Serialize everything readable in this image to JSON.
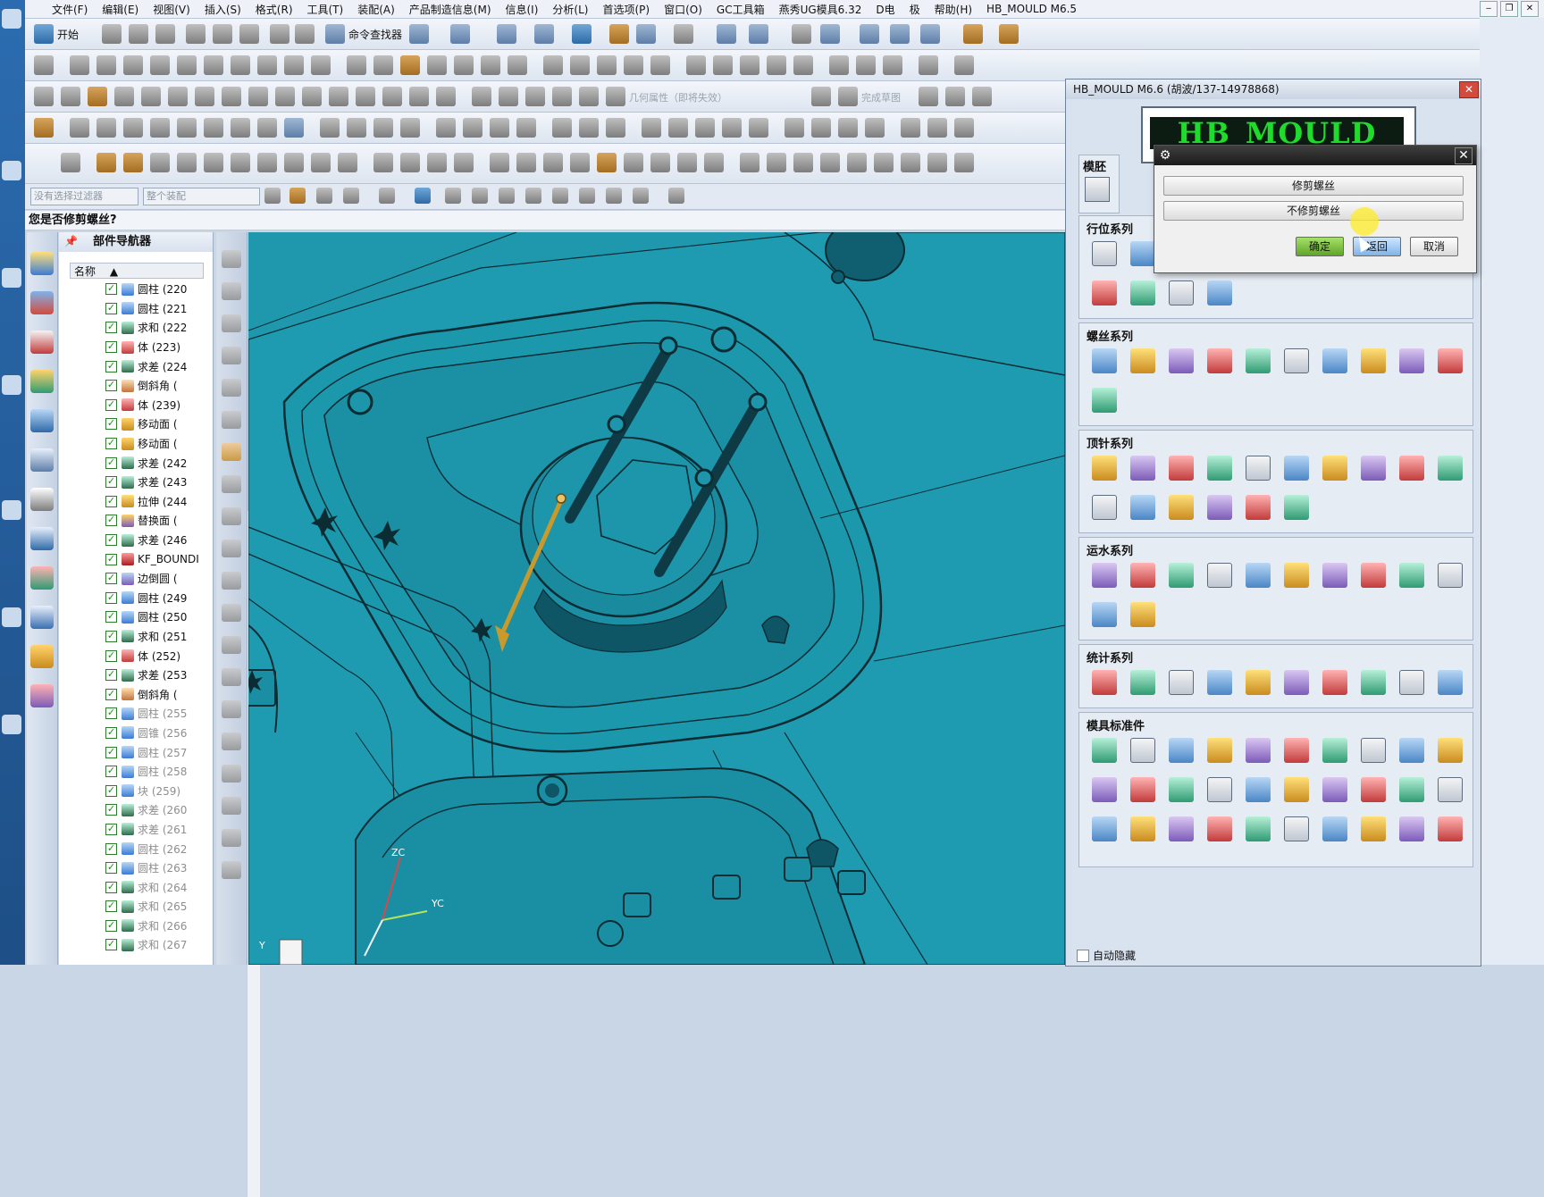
{
  "menu": [
    "文件(F)",
    "编辑(E)",
    "视图(V)",
    "插入(S)",
    "格式(R)",
    "工具(T)",
    "装配(A)",
    "产品制造信息(M)",
    "信息(I)",
    "分析(L)",
    "首选项(P)",
    "窗口(O)",
    "GC工具箱",
    "燕秀UG模具6.32",
    "D电",
    "极",
    "帮助(H)",
    "HB_MOULD M6.5"
  ],
  "window_controls": [
    "‒",
    "❐",
    "✕"
  ],
  "toolbar": {
    "start_label": "开始",
    "cmd_finder_label": "命令查找器",
    "geom_props_label": "几何属性（即将失效）",
    "finish_drawing_label": "完成草图",
    "select_filter_placeholder": "没有选择过滤器",
    "assembly_scope_placeholder": "整个装配"
  },
  "prompt": "您是否修剪螺丝?",
  "navigator": {
    "title": "部件导航器",
    "column_header": "名称",
    "items": [
      {
        "label": "圆柱 (220",
        "dim": false,
        "icon": "cylinder-icon"
      },
      {
        "label": "圆柱 (221",
        "dim": false,
        "icon": "cylinder-icon"
      },
      {
        "label": "求和 (222",
        "dim": false,
        "icon": "unite-icon"
      },
      {
        "label": "体 (223)",
        "dim": false,
        "icon": "body-icon"
      },
      {
        "label": "求差 (224",
        "dim": false,
        "icon": "subtract-icon"
      },
      {
        "label": "倒斜角 (",
        "dim": false,
        "icon": "chamfer-icon"
      },
      {
        "label": "体 (239)",
        "dim": false,
        "icon": "body-icon"
      },
      {
        "label": "移动面 (",
        "dim": false,
        "icon": "move-face-icon"
      },
      {
        "label": "移动面 (",
        "dim": false,
        "icon": "move-face-icon"
      },
      {
        "label": "求差 (242",
        "dim": false,
        "icon": "subtract-icon"
      },
      {
        "label": "求差 (243",
        "dim": false,
        "icon": "subtract-icon"
      },
      {
        "label": "拉伸 (244",
        "dim": false,
        "icon": "extrude-icon"
      },
      {
        "label": "替换面 (",
        "dim": false,
        "icon": "replace-face-icon"
      },
      {
        "label": "求差 (246",
        "dim": false,
        "icon": "subtract-icon"
      },
      {
        "label": "KF_BOUNDI",
        "dim": false,
        "icon": "kf-icon"
      },
      {
        "label": "边倒圆 (",
        "dim": false,
        "icon": "blend-icon"
      },
      {
        "label": "圆柱 (249",
        "dim": false,
        "icon": "cylinder-icon"
      },
      {
        "label": "圆柱 (250",
        "dim": false,
        "icon": "cylinder-icon"
      },
      {
        "label": "求和 (251",
        "dim": false,
        "icon": "unite-icon"
      },
      {
        "label": "体 (252)",
        "dim": false,
        "icon": "body-icon"
      },
      {
        "label": "求差 (253",
        "dim": false,
        "icon": "subtract-icon"
      },
      {
        "label": "倒斜角 (",
        "dim": false,
        "icon": "chamfer-icon"
      },
      {
        "label": "圆柱 (255",
        "dim": true,
        "icon": "cylinder-icon"
      },
      {
        "label": "圆锥 (256",
        "dim": true,
        "icon": "cone-icon"
      },
      {
        "label": "圆柱 (257",
        "dim": true,
        "icon": "cylinder-icon"
      },
      {
        "label": "圆柱 (258",
        "dim": true,
        "icon": "cylinder-icon"
      },
      {
        "label": "块 (259)",
        "dim": true,
        "icon": "block-icon"
      },
      {
        "label": "求差 (260",
        "dim": true,
        "icon": "subtract-icon"
      },
      {
        "label": "求差 (261",
        "dim": true,
        "icon": "subtract-icon"
      },
      {
        "label": "圆柱 (262",
        "dim": true,
        "icon": "cylinder-icon"
      },
      {
        "label": "圆柱 (263",
        "dim": true,
        "icon": "cylinder-icon"
      },
      {
        "label": "求和 (264",
        "dim": true,
        "icon": "unite-icon"
      },
      {
        "label": "求和 (265",
        "dim": true,
        "icon": "unite-icon"
      },
      {
        "label": "求和 (266",
        "dim": true,
        "icon": "unite-icon"
      },
      {
        "label": "求和 (267",
        "dim": true,
        "icon": "unite-icon"
      }
    ]
  },
  "hb_panel": {
    "title": "HB_MOULD M6.6 (胡波/137-14978868)",
    "logo_text": "HB_MOULD",
    "groups": [
      {
        "title": "行位系列",
        "rows": 2,
        "count": 14
      },
      {
        "title": "螺丝系列",
        "rows": 2,
        "count": 11
      },
      {
        "title": "顶针系列",
        "rows": 2,
        "count": 16
      },
      {
        "title": "运水系列",
        "rows": 2,
        "count": 12
      },
      {
        "title": "统计系列",
        "rows": 1,
        "count": 10
      },
      {
        "title": "模具标准件",
        "rows": 3,
        "count": 30
      }
    ],
    "autohide_label": "自动隐藏",
    "partial_tab": "模胚"
  },
  "dialog": {
    "options": [
      "修剪螺丝",
      "不修剪螺丝"
    ],
    "ok": "确定",
    "back": "返回",
    "cancel": "取消"
  },
  "viewport": {
    "axis_labels": [
      "ZC",
      "YC",
      "Y"
    ]
  },
  "colors": {
    "viewport_bg": "#1f97ad",
    "part_face": "#1e9bb1",
    "edge": "#0b2c33",
    "logo_green": "#1fdc2c"
  }
}
